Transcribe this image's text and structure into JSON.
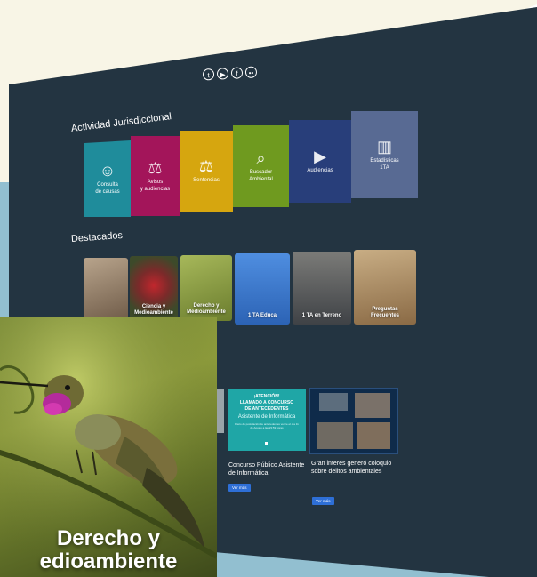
{
  "social": {
    "icons": [
      "twitter-icon",
      "youtube-icon",
      "facebook-icon",
      "flickr-icon"
    ],
    "glyphs": [
      "t",
      "▶",
      "f",
      "••"
    ]
  },
  "jurisdictional": {
    "title": "Actividad Jurisdiccional",
    "tiles": [
      {
        "line1": "Consulta",
        "line2": "de causas",
        "icon": "people-icon",
        "glyph": "☺",
        "color": "#1f8c9b"
      },
      {
        "line1": "Avisos",
        "line2": "y audiencias",
        "icon": "gavel-icon",
        "glyph": "⚖",
        "color": "#a3155a"
      },
      {
        "line1": "Sentencias",
        "line2": "",
        "icon": "scales-icon",
        "glyph": "⚖",
        "color": "#d6a60f"
      },
      {
        "line1": "Buscador",
        "line2": "Ambiental",
        "icon": "search-globe-icon",
        "glyph": "⌕",
        "color": "#6f9a1f"
      },
      {
        "line1": "Audiencias",
        "line2": "",
        "icon": "play-icon",
        "glyph": "▶",
        "color": "#283e7a"
      },
      {
        "line1": "Estadísticas",
        "line2": "1TA",
        "icon": "chart-icon",
        "glyph": "▥",
        "color": "#586a93"
      }
    ]
  },
  "featured": {
    "title": "Destacados",
    "items": [
      {
        "label": "",
        "color": "#8a7561"
      },
      {
        "label": "Ciencia y\nMedioambiente",
        "color": "#7b2a2a"
      },
      {
        "label": "Derecho y\nMedioambiente",
        "color": "#8ea23f"
      },
      {
        "label": "1 TA Educa",
        "color": "#3b79c9"
      },
      {
        "label": "1 TA en Terreno",
        "color": "#4d5157"
      },
      {
        "label": "Preguntas\nFrecuentes",
        "color": "#a0805a"
      }
    ]
  },
  "news": {
    "card1": {
      "banner_line1": "¡ATENCIÓN!",
      "banner_line2": "LLAMADO A CONCURSO",
      "banner_line3": "DE ANTECEDENTES",
      "banner_sub": "Asistente de Informática",
      "banner_note": "Plazo de postulación de antecedentes vence el día 11 de Agosto a las 23:59 horas",
      "title": "Concurso Público Asistente de Informática",
      "button": "Ver más"
    },
    "card2": {
      "title": "Gran interés generó coloquio sobre delitos ambientales",
      "button": "Ver más"
    }
  },
  "zoom_card": {
    "label": "Derecho y\nedioambiente"
  }
}
